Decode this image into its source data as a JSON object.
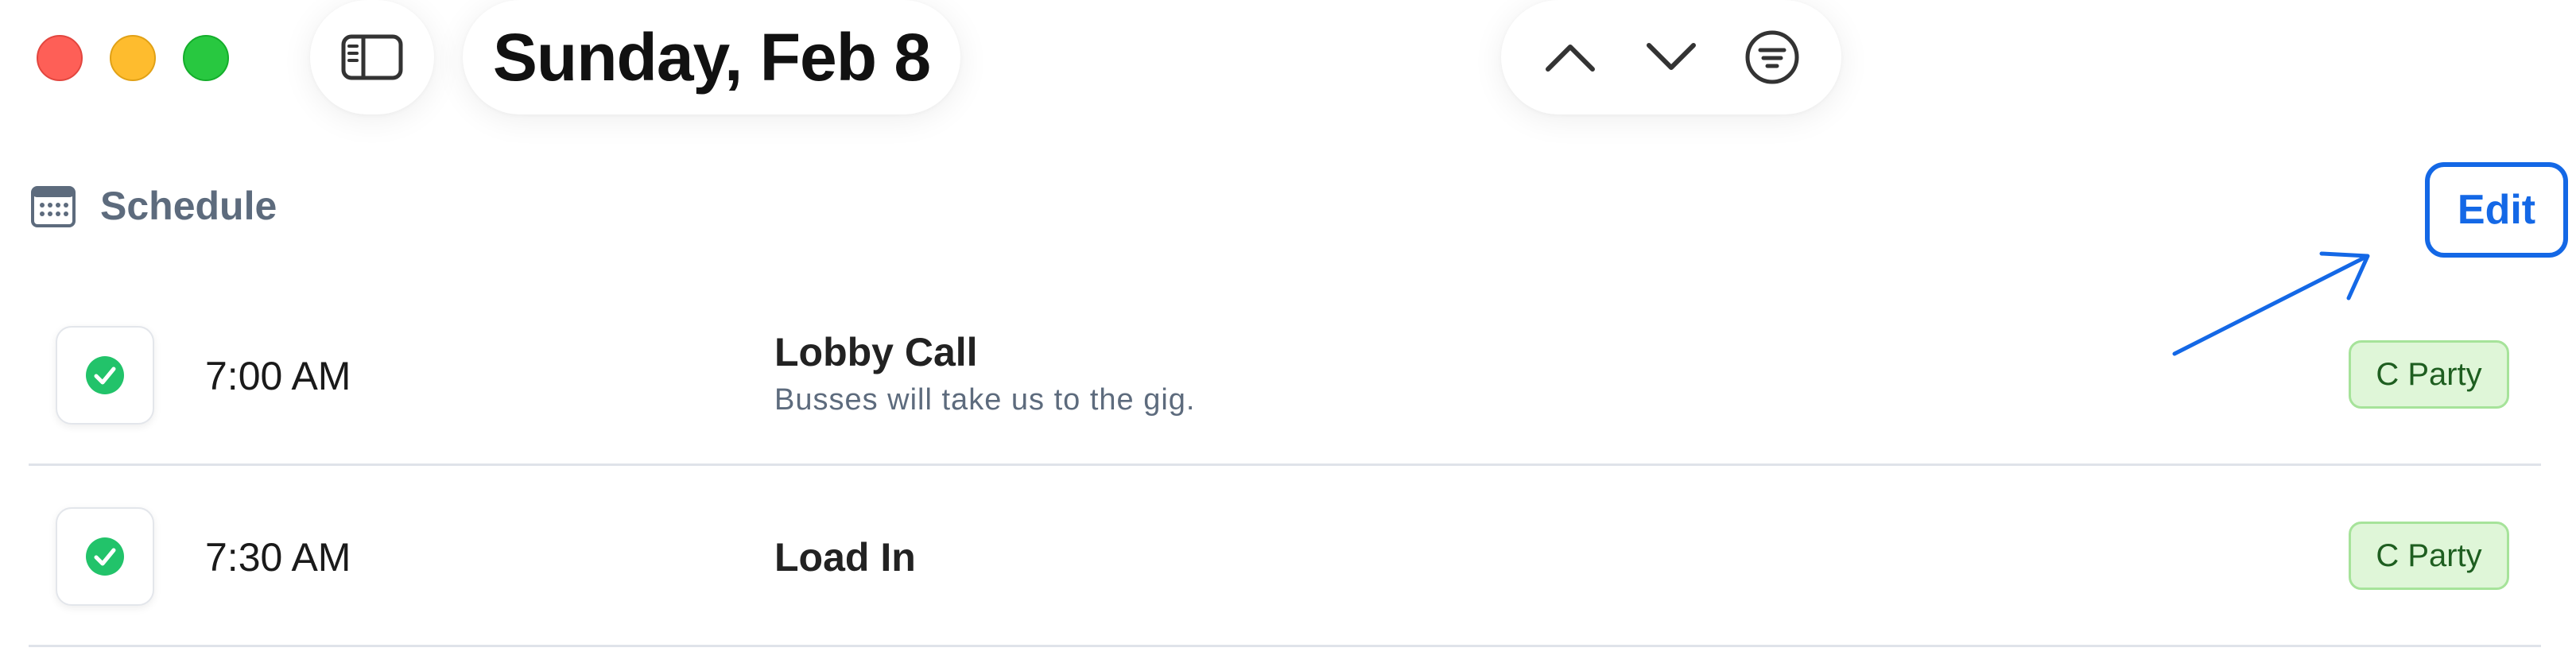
{
  "window": {
    "controls": [
      "close",
      "minimize",
      "zoom"
    ],
    "sidebar_toggle_icon": "sidebar-icon",
    "title": "Sunday, Feb 8",
    "nav_icons": [
      "chevron-up-icon",
      "chevron-down-icon",
      "filter-icon"
    ]
  },
  "section": {
    "icon": "calendar-icon",
    "title": "Schedule",
    "edit_label": "Edit"
  },
  "events": [
    {
      "time": "7:00 AM",
      "title": "Lobby Call",
      "subtitle": "Busses will take us to the gig.",
      "tag": "C Party",
      "done": true
    },
    {
      "time": "7:30 AM",
      "title": "Load In",
      "subtitle": "",
      "tag": "C Party",
      "done": true
    }
  ],
  "colors": {
    "accent": "#1468e6",
    "check": "#22c36a",
    "tag_bg": "#dff6d8",
    "tag_text": "#1e5e20"
  }
}
